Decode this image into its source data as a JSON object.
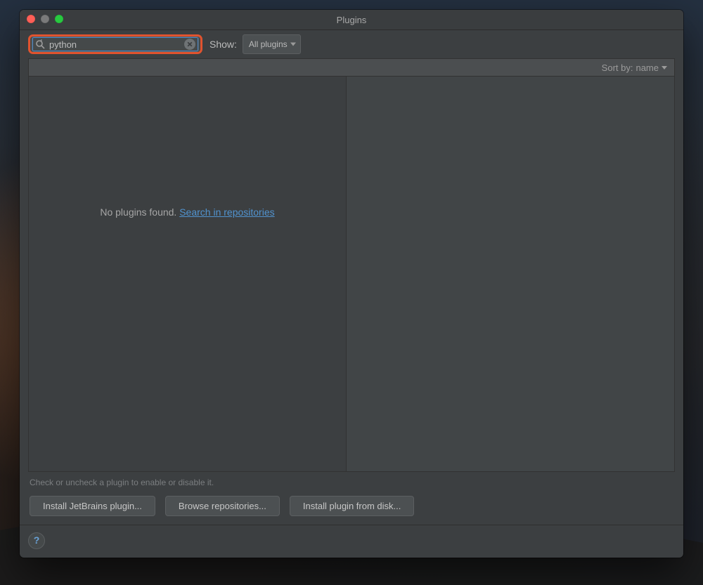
{
  "window": {
    "title": "Plugins"
  },
  "search": {
    "value": "python"
  },
  "show": {
    "label": "Show:",
    "selected": "All plugins"
  },
  "sort": {
    "prefix": "Sort by:",
    "value": "name"
  },
  "list": {
    "empty_text": "No plugins found.",
    "search_link": "Search in repositories"
  },
  "hint": "Check or uncheck a plugin to enable or disable it.",
  "buttons": {
    "jetbrains": "Install JetBrains plugin...",
    "browse": "Browse repositories...",
    "disk": "Install plugin from disk..."
  },
  "help": {
    "label": "?"
  }
}
